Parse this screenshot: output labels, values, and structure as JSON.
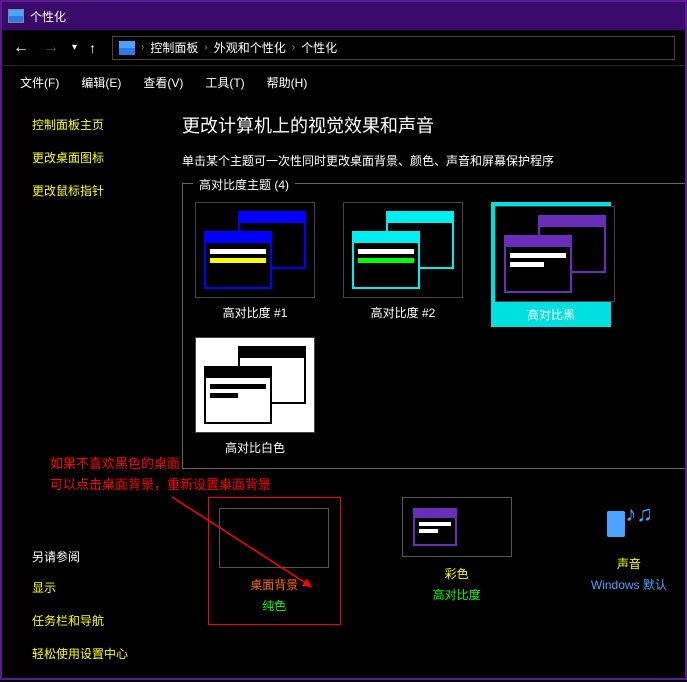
{
  "window": {
    "title": "个性化"
  },
  "breadcrumb": [
    "控制面板",
    "外观和个性化",
    "个性化"
  ],
  "menus": [
    "文件(F)",
    "编辑(E)",
    "查看(V)",
    "工具(T)",
    "帮助(H)"
  ],
  "sidebar": {
    "links": [
      "控制面板主页",
      "更改桌面图标",
      "更改鼠标指针"
    ],
    "see_also_head": "另请参阅",
    "see_also": [
      "显示",
      "任务栏和导航",
      "轻松使用设置中心"
    ]
  },
  "main": {
    "heading": "更改计算机上的视觉效果和声音",
    "sub": "单击某个主题可一次性同时更改桌面背景、颜色、声音和屏幕保护程序",
    "theme_group": "高对比度主题 (4)",
    "themes": [
      "高对比度 #1",
      "高对比度 #2",
      "高对比黑",
      "高对比白色"
    ],
    "bottom": [
      {
        "l1": "桌面背景",
        "l2": "纯色"
      },
      {
        "l1": "彩色",
        "l2": "高对比度"
      },
      {
        "l1": "声音",
        "l2": "Windows 默认"
      }
    ]
  },
  "annotation": {
    "line1": "如果不喜欢黑色的桌面",
    "line2": "可以点击桌面背景，重新设置桌面背景"
  }
}
